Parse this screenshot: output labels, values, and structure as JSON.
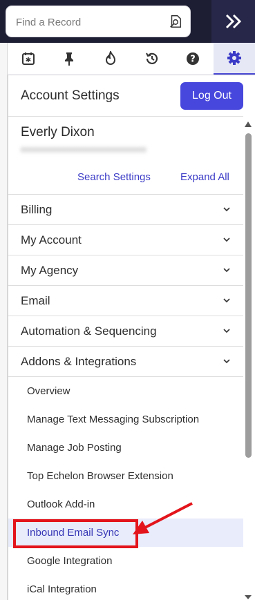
{
  "search": {
    "placeholder": "Find a Record"
  },
  "tabs": [
    {
      "icon": "calendar-star-icon"
    },
    {
      "icon": "pushpin-icon"
    },
    {
      "icon": "flame-icon"
    },
    {
      "icon": "history-icon"
    },
    {
      "icon": "help-icon"
    },
    {
      "icon": "gear-icon",
      "active": true
    }
  ],
  "header": {
    "title": "Account Settings",
    "logout_label": "Log Out"
  },
  "user": {
    "name": "Everly Dixon",
    "email": "redacted"
  },
  "links": {
    "search_settings": "Search Settings",
    "expand_all": "Expand All"
  },
  "sections": [
    {
      "label": "Billing"
    },
    {
      "label": "My Account"
    },
    {
      "label": "My Agency"
    },
    {
      "label": "Email"
    },
    {
      "label": "Automation & Sequencing"
    },
    {
      "label": "Addons & Integrations"
    }
  ],
  "subitems": [
    {
      "label": "Overview"
    },
    {
      "label": "Manage Text Messaging Subscription"
    },
    {
      "label": "Manage Job Posting"
    },
    {
      "label": "Top Echelon Browser Extension"
    },
    {
      "label": "Outlook Add-in"
    },
    {
      "label": "Inbound Email Sync",
      "active": true
    },
    {
      "label": "Google Integration"
    },
    {
      "label": "iCal Integration"
    }
  ],
  "colors": {
    "accent": "#4747dd",
    "topbar": "#1d1d33",
    "highlight": "#e3141b"
  }
}
